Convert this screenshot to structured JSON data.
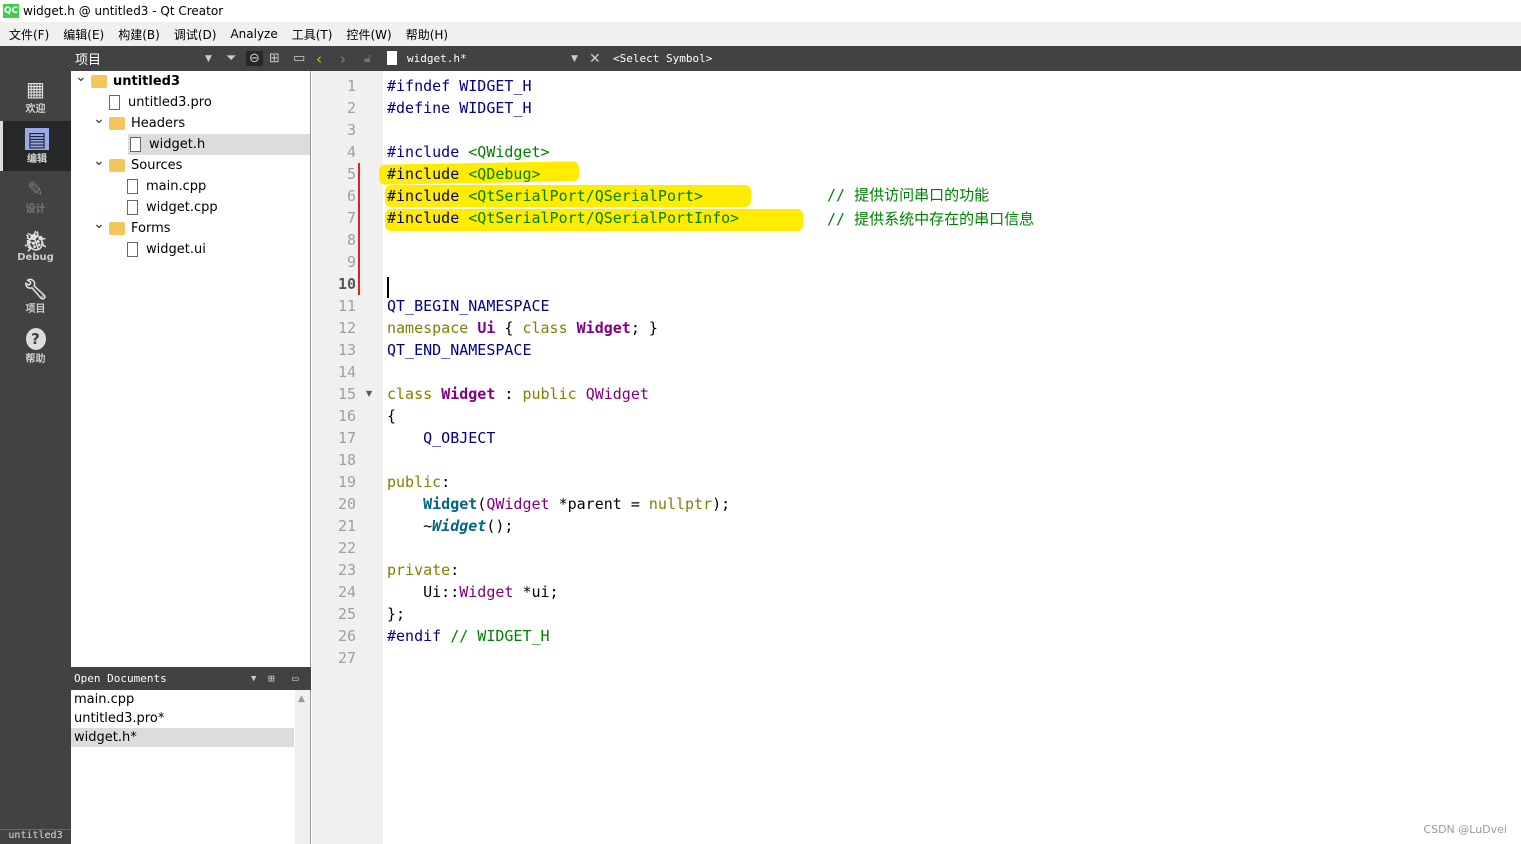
{
  "window": {
    "title": "widget.h @ untitled3 - Qt Creator",
    "app_icon": "QC"
  },
  "menu": [
    "文件(F)",
    "编辑(E)",
    "构建(B)",
    "调试(D)",
    "Analyze",
    "工具(T)",
    "控件(W)",
    "帮助(H)"
  ],
  "toolbar": {
    "project_selector": "项目",
    "file_name": "widget.h*",
    "symbol": "<Select Symbol>"
  },
  "modes": [
    {
      "label": "欢迎",
      "icon": "grid-icon"
    },
    {
      "label": "编辑",
      "icon": "edit-doc-icon",
      "active": true
    },
    {
      "label": "设计",
      "icon": "pencil-icon",
      "disabled": true
    },
    {
      "label": "Debug",
      "icon": "bug-icon"
    },
    {
      "label": "项目",
      "icon": "wrench-icon"
    },
    {
      "label": "帮助",
      "icon": "help-icon"
    }
  ],
  "tree": [
    {
      "label": "untitled3",
      "level": 0,
      "type": "project",
      "expanded": true
    },
    {
      "label": "untitled3.pro",
      "level": 1,
      "type": "pro"
    },
    {
      "label": "Headers",
      "level": 1,
      "type": "folder",
      "expanded": true
    },
    {
      "label": "widget.h",
      "level": 2,
      "type": "file",
      "selected": true
    },
    {
      "label": "Sources",
      "level": 1,
      "type": "folder",
      "expanded": true
    },
    {
      "label": "main.cpp",
      "level": 2,
      "type": "file"
    },
    {
      "label": "widget.cpp",
      "level": 2,
      "type": "file"
    },
    {
      "label": "Forms",
      "level": 1,
      "type": "folder",
      "expanded": true
    },
    {
      "label": "widget.ui",
      "level": 2,
      "type": "form"
    }
  ],
  "open_documents": {
    "title": "Open Documents",
    "items": [
      {
        "label": "main.cpp"
      },
      {
        "label": "untitled3.pro*"
      },
      {
        "label": "widget.h*",
        "selected": true
      }
    ]
  },
  "status": {
    "project": "untitled3"
  },
  "editor": {
    "current_line": 10,
    "lines": [
      [
        [
          "#ifndef WIDGET_H",
          "pp"
        ]
      ],
      [
        [
          "#define WIDGET_H",
          "pp"
        ]
      ],
      [],
      [
        [
          "#include ",
          "pp"
        ],
        [
          "<QWidget>",
          "str"
        ]
      ],
      [
        [
          "#include ",
          "pp"
        ],
        [
          "<QDebug>",
          "str"
        ]
      ],
      [
        [
          "#include ",
          "pp"
        ],
        [
          "<QtSerialPort/QSerialPort>",
          "str"
        ]
      ],
      [
        [
          "#include ",
          "pp"
        ],
        [
          "<QtSerialPort/QSerialPortInfo>",
          "str"
        ]
      ],
      [],
      [],
      [],
      [
        [
          "QT_BEGIN_NAMESPACE",
          "mac"
        ]
      ],
      [
        [
          "namespace ",
          "kw"
        ],
        [
          "Ui",
          "ty"
        ],
        [
          " { ",
          ""
        ],
        [
          "class ",
          "kw"
        ],
        [
          "Widget",
          "ty"
        ],
        [
          "; }",
          ""
        ]
      ],
      [
        [
          "QT_END_NAMESPACE",
          "mac"
        ]
      ],
      [],
      [
        [
          "class ",
          "kw"
        ],
        [
          "Widget",
          "ty"
        ],
        [
          " : ",
          ""
        ],
        [
          "public ",
          "kw"
        ],
        [
          "QWidget",
          "ty2"
        ]
      ],
      [
        [
          "{",
          ""
        ]
      ],
      [
        [
          "    Q_OBJECT",
          "mac"
        ]
      ],
      [],
      [
        [
          "public",
          "kw"
        ],
        [
          ":",
          ""
        ]
      ],
      [
        [
          "    ",
          ""
        ],
        [
          "Widget",
          "fn"
        ],
        [
          "(",
          ""
        ],
        [
          "QWidget",
          "ty2"
        ],
        [
          " *parent = ",
          ""
        ],
        [
          "nullptr",
          "kw"
        ],
        [
          ");",
          ""
        ]
      ],
      [
        [
          "    ~",
          ""
        ],
        [
          "Widget",
          "fni"
        ],
        [
          "();",
          ""
        ]
      ],
      [],
      [
        [
          "private",
          "kw"
        ],
        [
          ":",
          ""
        ]
      ],
      [
        [
          "    Ui::",
          ""
        ],
        [
          "Widget",
          "ty2"
        ],
        [
          " *ui;",
          ""
        ]
      ],
      [
        [
          "};",
          ""
        ]
      ],
      [
        [
          "#endif ",
          "pp"
        ],
        [
          "// WIDGET_H",
          "cm"
        ]
      ],
      []
    ],
    "comments": [
      "// 提供访问串口的功能",
      "// 提供系统中存在的串口信息"
    ]
  },
  "watermark": "CSDN @LuDvei"
}
